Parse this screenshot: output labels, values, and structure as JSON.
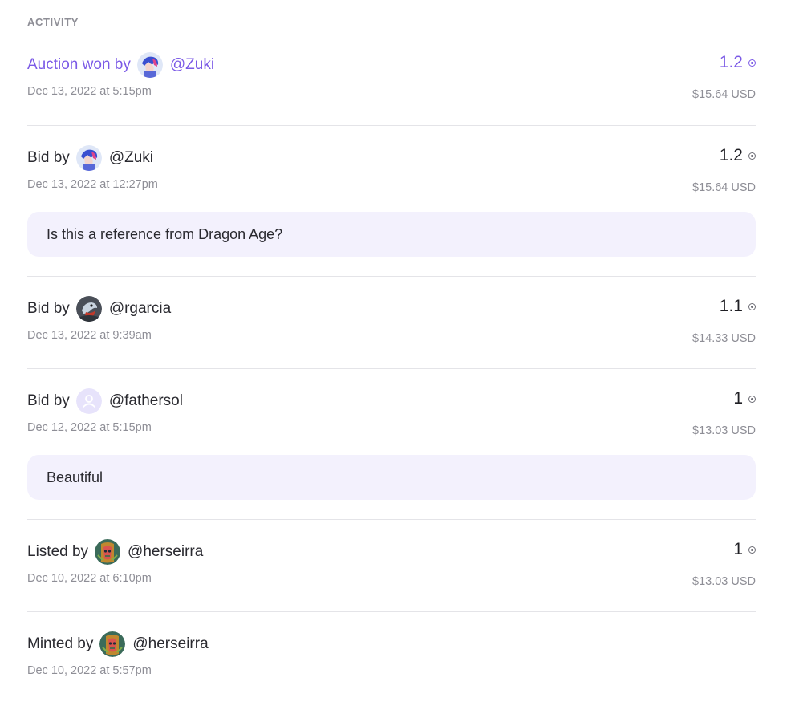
{
  "section": {
    "title": "ACTIVITY"
  },
  "activities": [
    {
      "action": "Auction won by",
      "user": "@Zuki",
      "date": "Dec 13, 2022 at 5:15pm",
      "amount": "1.2",
      "usd": "$15.64 USD",
      "avatar": "zuki-avatar"
    },
    {
      "action": "Bid by",
      "user": "@Zuki",
      "date": "Dec 13, 2022 at 12:27pm",
      "amount": "1.2",
      "usd": "$15.64 USD",
      "comment": "Is this a reference from Dragon Age?",
      "avatar": "zuki-avatar"
    },
    {
      "action": "Bid by",
      "user": "@rgarcia",
      "date": "Dec 13, 2022 at 9:39am",
      "amount": "1.1",
      "usd": "$14.33 USD",
      "avatar": "rgarcia-avatar"
    },
    {
      "action": "Bid by",
      "user": "@fathersol",
      "date": "Dec 12, 2022 at 5:15pm",
      "amount": "1",
      "usd": "$13.03 USD",
      "comment": "Beautiful",
      "avatar": "default-user-avatar"
    },
    {
      "action": "Listed by",
      "user": "@herseirra",
      "date": "Dec 10, 2022 at 6:10pm",
      "amount": "1",
      "usd": "$13.03 USD",
      "avatar": "herseirra-avatar"
    },
    {
      "action": "Minted by",
      "user": "@herseirra",
      "date": "Dec 10, 2022 at 5:57pm",
      "avatar": "herseirra-avatar"
    }
  ],
  "colors": {
    "accent": "#7b5ae6",
    "muted": "#8e8e96",
    "comment_bg": "#f3f1fd",
    "divider": "#e4e4e8"
  },
  "icons": {
    "currency": "sol-icon"
  }
}
